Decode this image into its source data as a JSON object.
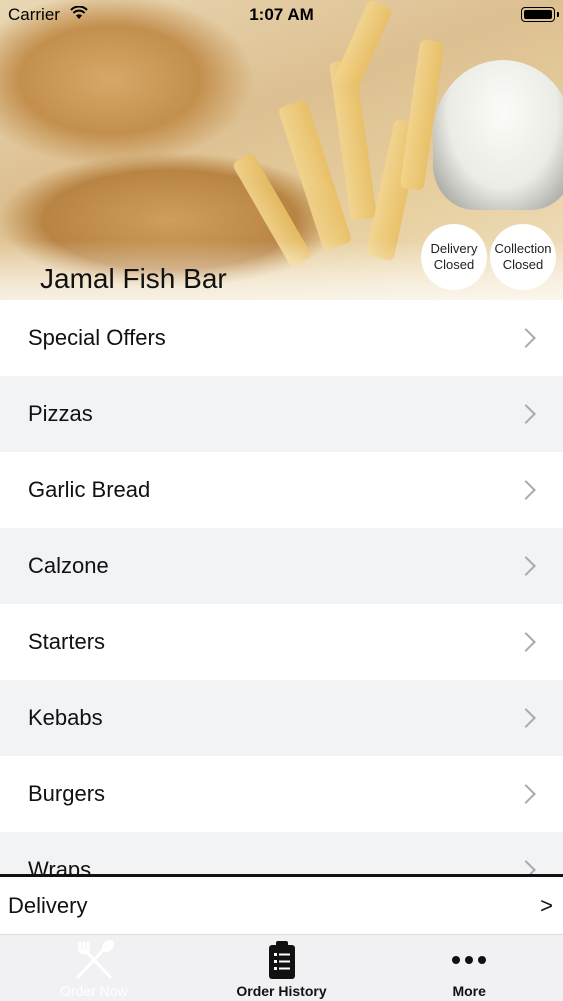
{
  "status_bar": {
    "carrier": "Carrier",
    "time": "1:07 AM"
  },
  "header": {
    "restaurant_name": "Jamal Fish Bar",
    "badges": {
      "delivery": {
        "line1": "Delivery",
        "line2": "Closed"
      },
      "collection": {
        "line1": "Collection",
        "line2": "Closed"
      }
    }
  },
  "menu": {
    "items": [
      {
        "label": "Special Offers"
      },
      {
        "label": "Pizzas"
      },
      {
        "label": "Garlic Bread"
      },
      {
        "label": "Calzone"
      },
      {
        "label": "Starters"
      },
      {
        "label": "Kebabs"
      },
      {
        "label": "Burgers"
      },
      {
        "label": "Wraps"
      }
    ]
  },
  "order_mode": {
    "label": "Delivery",
    "arrow": ">"
  },
  "tab_bar": {
    "tabs": [
      {
        "label": "Order Now",
        "icon": "fork-knife-icon",
        "active": true
      },
      {
        "label": "Order History",
        "icon": "clipboard-list-icon",
        "active": false
      },
      {
        "label": "More",
        "icon": "more-dots-icon",
        "active": false
      }
    ]
  },
  "colors": {
    "alt_row": "#f2f3f5",
    "tab_bar_bg": "#f1f1f3",
    "text": "#111111"
  }
}
